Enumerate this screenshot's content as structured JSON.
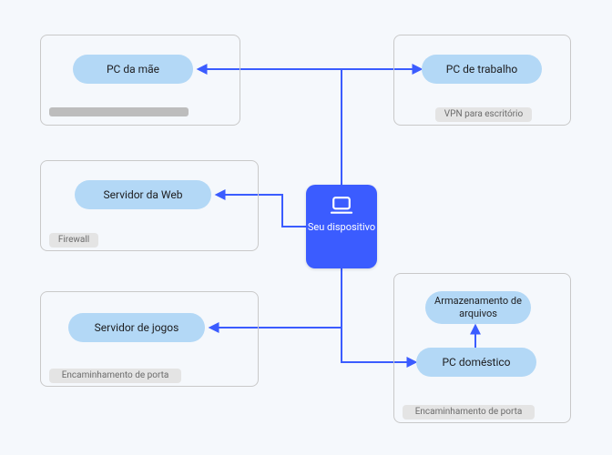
{
  "hub": {
    "label": "Seu dispositivo",
    "icon": "laptop-icon"
  },
  "nodes": {
    "top_left": {
      "pill": "PC da mãe",
      "tag": ""
    },
    "top_right": {
      "pill": "PC de trabalho",
      "tag": "VPN para escritório"
    },
    "mid_left": {
      "pill": "Servidor da Web",
      "tag": "Firewall"
    },
    "bot_left": {
      "pill": "Servidor de jogos",
      "tag": "Encaminhamento de porta"
    },
    "bot_right": {
      "pill_top": "Armazenamento de arquivos",
      "pill_bottom": "PC doméstico",
      "tag": "Encaminhamento de porta"
    }
  },
  "colors": {
    "connector": "#3b5cff",
    "pill_bg": "#b3d8f6",
    "hub_bg": "#3b5cff",
    "box_border": "#c9c9c9",
    "tag_bg": "#e4e4e4",
    "tag_text": "#6b6b6b",
    "page_bg": "#f5f8fc"
  }
}
